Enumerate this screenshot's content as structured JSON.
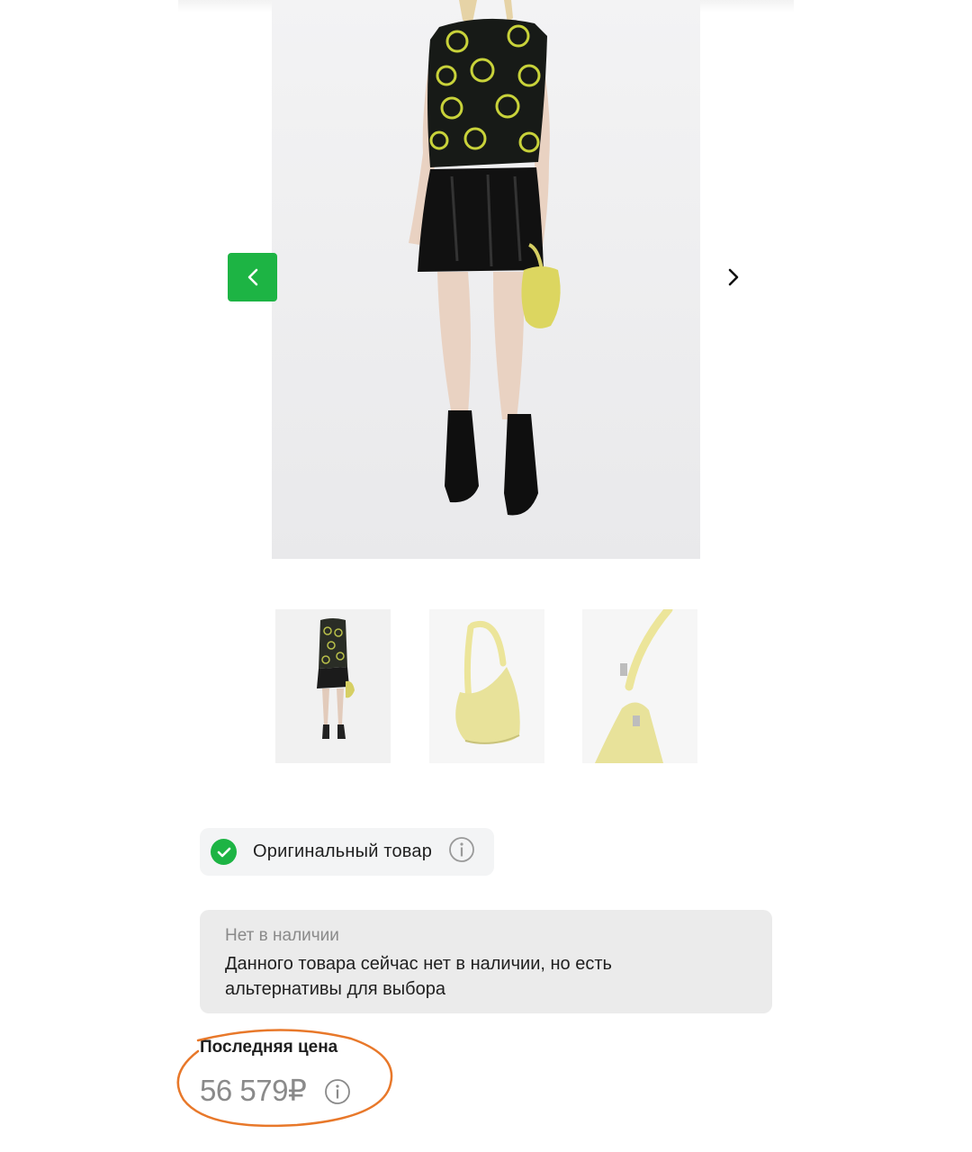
{
  "gallery": {
    "main_image": "woman-in-black-knit-vest-leather-skirt-yellow-bag",
    "prev_icon": "chevron-left-icon",
    "next_icon": "chevron-right-icon",
    "thumbnails": [
      {
        "name": "full-look-thumbnail"
      },
      {
        "name": "yellow-bag-thumbnail"
      },
      {
        "name": "bag-detail-thumbnail"
      }
    ]
  },
  "original_badge": {
    "label": "Оригинальный товар",
    "icon": "check-circle-icon",
    "info_icon": "info-icon"
  },
  "availability": {
    "title": "Нет в наличии",
    "text": "Данного товара сейчас нет в наличии, но есть альтернативы для выбора"
  },
  "price": {
    "label": "Последняя цена",
    "value": "56 579₽",
    "info_icon": "info-icon"
  },
  "colors": {
    "accent": "#1db444",
    "muted_text": "#8a8a8a",
    "annotation": "#e8782a"
  }
}
